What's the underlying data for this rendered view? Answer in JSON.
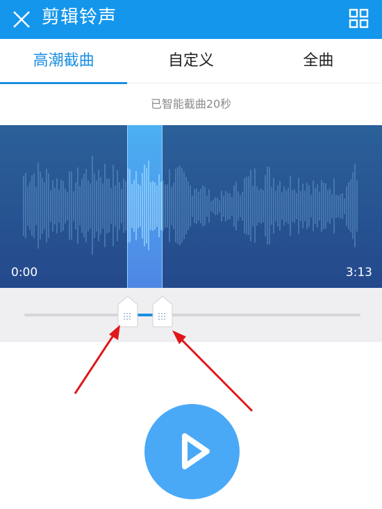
{
  "header": {
    "title": "剪辑铃声",
    "close_icon": "close-icon",
    "menu_icon": "grid-icon",
    "background": "#1496ec"
  },
  "tabs": [
    {
      "label": "高潮截曲",
      "active": true
    },
    {
      "label": "自定义",
      "active": false
    },
    {
      "label": "全曲",
      "active": false
    }
  ],
  "status_text": "已智能截曲20秒",
  "waveform": {
    "start_time": "0:00",
    "end_time": "3:13"
  },
  "colors": {
    "accent": "#1b8fe0",
    "play_button": "#4aa9f7",
    "annotation_arrow": "#e0161a"
  },
  "play_icon": "play-icon"
}
